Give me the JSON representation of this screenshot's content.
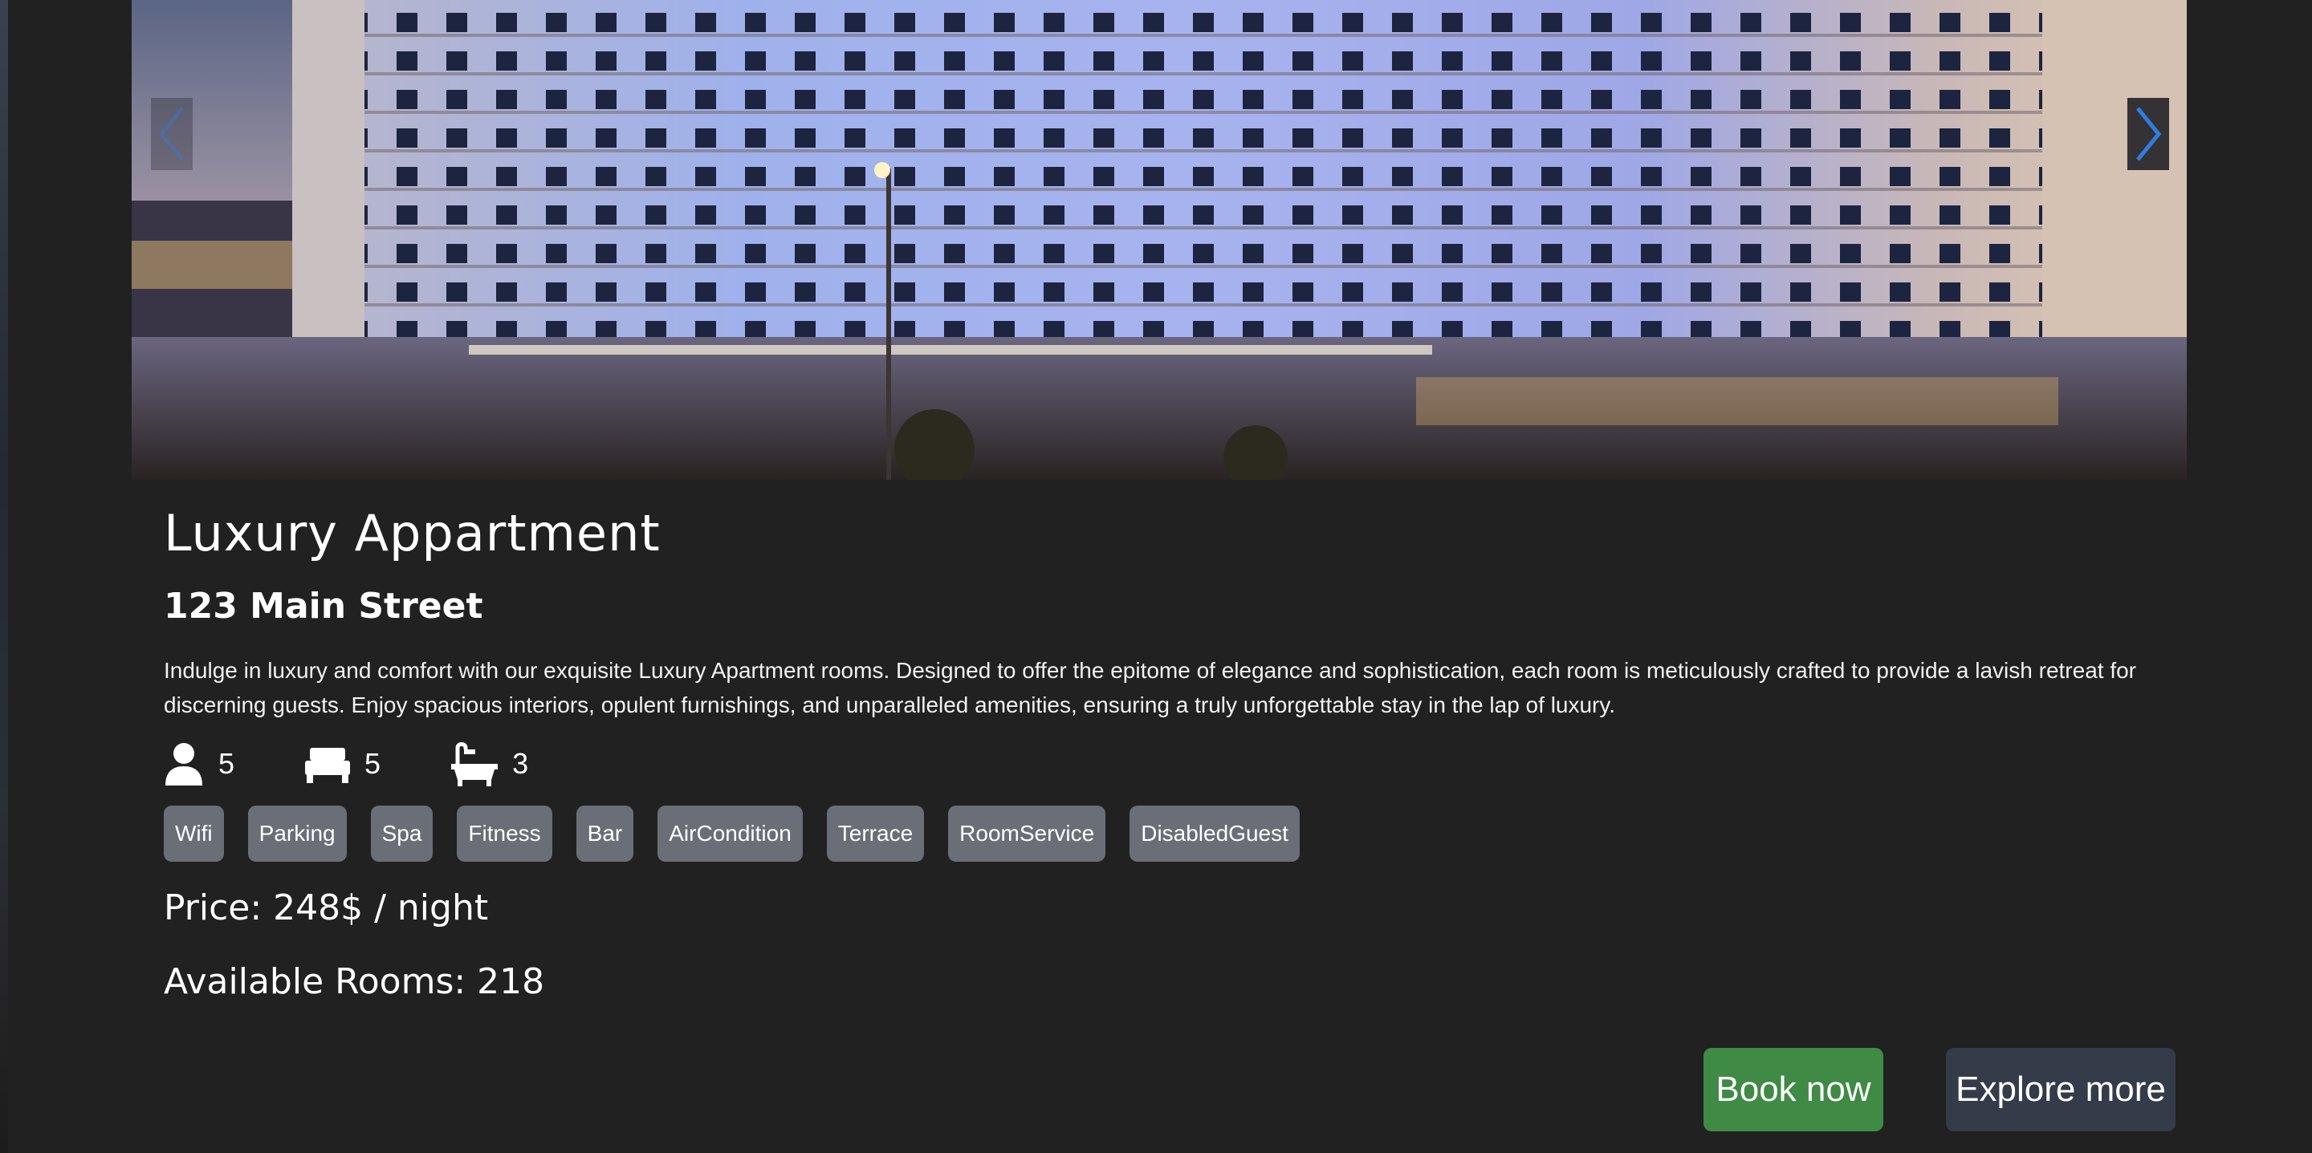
{
  "carousel": {
    "prev_icon": "chevron-left-icon",
    "next_icon": "chevron-right-icon"
  },
  "listing": {
    "title": "Luxury Appartment",
    "address": "123 Main Street",
    "description": "Indulge in luxury and comfort with our exquisite Luxury Apartment rooms. Designed to offer the epitome of elegance and sophistication, each room is meticulously crafted to provide a lavish retreat for discerning guests. Enjoy spacious interiors, opulent furnishings, and unparalleled amenities, ensuring a truly unforgettable stay in the lap of luxury.",
    "stats": {
      "guests": "5",
      "beds": "5",
      "baths": "3",
      "guests_icon": "person-icon",
      "beds_icon": "bed-icon",
      "baths_icon": "bathtub-icon"
    },
    "amenities": [
      "Wifi",
      "Parking",
      "Spa",
      "Fitness",
      "Bar",
      "AirCondition",
      "Terrace",
      "RoomService",
      "DisabledGuest"
    ],
    "price": "Price: 248$ / night",
    "available_rooms": "Available Rooms: 218"
  },
  "actions": {
    "book_label": "Book now",
    "explore_label": "Explore more"
  },
  "colors": {
    "background": "#212121",
    "badge": "#6a6e76",
    "book_button": "#3f8a45",
    "explore_button": "#343b49",
    "chevron": "#2f7de1"
  }
}
